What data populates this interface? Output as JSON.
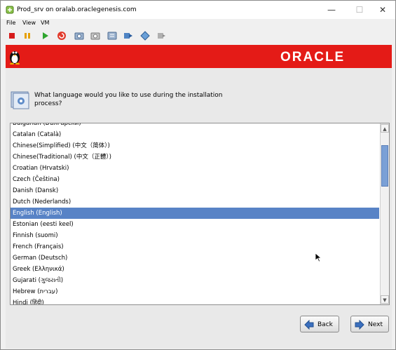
{
  "window": {
    "title": "Prod_srv on oralab.oraclegenesis.com",
    "min_glyph": "—",
    "max_glyph": "☐",
    "close_glyph": "✕"
  },
  "menu": [
    {
      "label": "File"
    },
    {
      "label": "View"
    },
    {
      "label": "VM"
    }
  ],
  "toolbar_icons": [
    "stop-icon",
    "pause-icon",
    "play-icon",
    "refresh-icon",
    "snapshot-icon",
    "revert-snapshot-icon",
    "manage-snapshots-icon",
    "send-ctrl-alt-del-icon",
    "console-settings-icon",
    "vm-settings-icon"
  ],
  "banner": {
    "logo": "ORACLE",
    "color": "#e41b17"
  },
  "installer": {
    "question": "What language would you like to use during the installation process?",
    "languages": [
      "Bulgarian (Български)",
      "Catalan (Català)",
      "Chinese(Simplified) (中文（简体）)",
      "Chinese(Traditional) (中文（正體）)",
      "Croatian (Hrvatski)",
      "Czech (Čeština)",
      "Danish (Dansk)",
      "Dutch (Nederlands)",
      "English (English)",
      "Estonian (eesti keel)",
      "Finnish (suomi)",
      "French (Français)",
      "German (Deutsch)",
      "Greek (Ελληνικά)",
      "Gujarati (ગુજરાતી)",
      "Hebrew (עברית)",
      "Hindi (हिंदी)"
    ],
    "selected": "English (English)",
    "back_label": "Back",
    "next_label": "Next",
    "selection_color": "#5883c6"
  }
}
